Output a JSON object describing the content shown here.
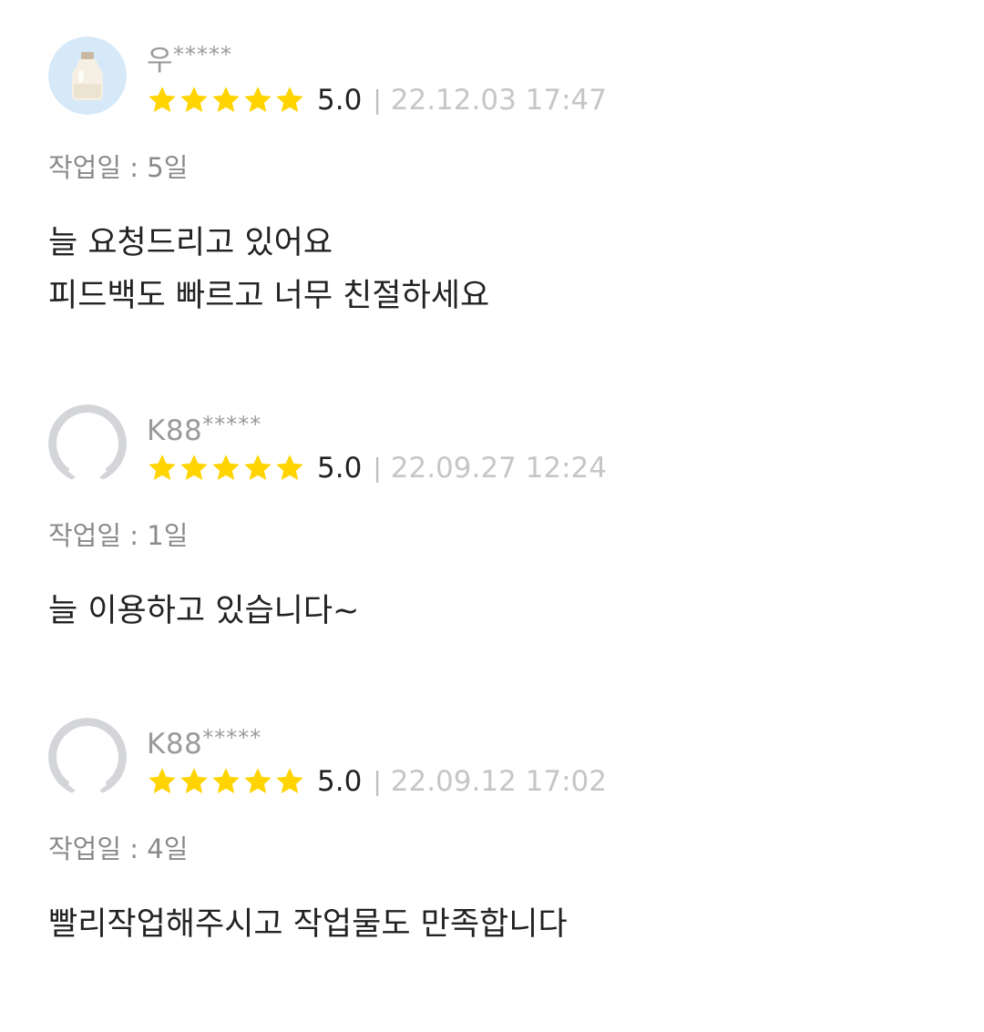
{
  "reviews": [
    {
      "avatar": "milk-bottle-avatar",
      "username_prefix": "우",
      "username_mask": "*****",
      "rating": "5.0",
      "stars": 5,
      "separator": "|",
      "date": "22.12.03 17:47",
      "workdays_label": "작업일 : ",
      "workdays_value": "5일",
      "comment_lines": [
        "늘 요청드리고 있어요",
        "피드백도 빠르고 너무 친절하세요"
      ]
    },
    {
      "avatar": "default-profile-avatar",
      "username_prefix": "K88",
      "username_mask": "*****",
      "rating": "5.0",
      "stars": 5,
      "separator": "|",
      "date": "22.09.27 12:24",
      "workdays_label": "작업일 : ",
      "workdays_value": "1일",
      "comment_lines": [
        "늘 이용하고 있습니다~"
      ]
    },
    {
      "avatar": "default-profile-avatar",
      "username_prefix": "K88",
      "username_mask": "*****",
      "rating": "5.0",
      "stars": 5,
      "separator": "|",
      "date": "22.09.12 17:02",
      "workdays_label": "작업일 : ",
      "workdays_value": "4일",
      "comment_lines": [
        "빨리작업해주시고 작업물도 만족합니다"
      ]
    }
  ],
  "colors": {
    "star": "#FFD400",
    "username": "#9a9a9a",
    "date": "#c6c6c6",
    "text": "#222222",
    "meta": "#8a8a8a"
  }
}
